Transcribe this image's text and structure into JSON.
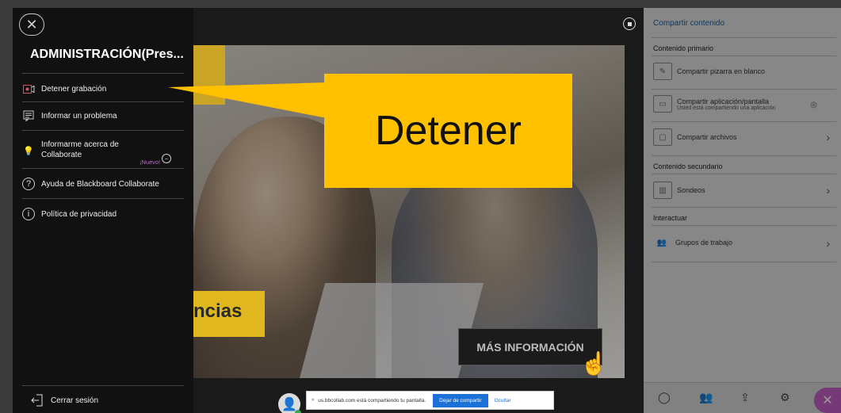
{
  "menu": {
    "title": "ADMINISTRACIÓN(Pres...",
    "items": [
      {
        "label": "Detener grabación"
      },
      {
        "label": "Informar un problema"
      },
      {
        "label": "Informarme acerca de Collaborate"
      },
      {
        "label": "Ayuda de Blackboard Collaborate"
      },
      {
        "label": "Política de privacidad"
      }
    ],
    "nuevo": "¡Nuevo!",
    "logout": "Cerrar sesión"
  },
  "callout": {
    "text": "Detener"
  },
  "slide": {
    "partial_word": "ncias",
    "more_button": "MÁS INFORMACIÓN"
  },
  "panel": {
    "title": "Compartir contenido",
    "primary_section": "Contenido primario",
    "whiteboard": "Compartir pizarra en blanco",
    "app_share": "Compartir aplicación/pantalla",
    "app_share_sub": "Usted está compartiendo una aplicación",
    "files": "Compartir archivos",
    "secondary_section": "Contenido secundario",
    "polls": "Sondeos",
    "interact_section": "Interactuar",
    "groups": "Grupos de trabajo"
  },
  "share_bar": {
    "message": "us.bbcollab.com está compartiendo tu pantalla.",
    "stop": "Dejar de compartir",
    "hide": "Ocultar"
  },
  "colors": {
    "accent": "#ffc000",
    "link": "#1c71d8",
    "nuevo": "#c06ad9",
    "close": "#c55fc9"
  }
}
